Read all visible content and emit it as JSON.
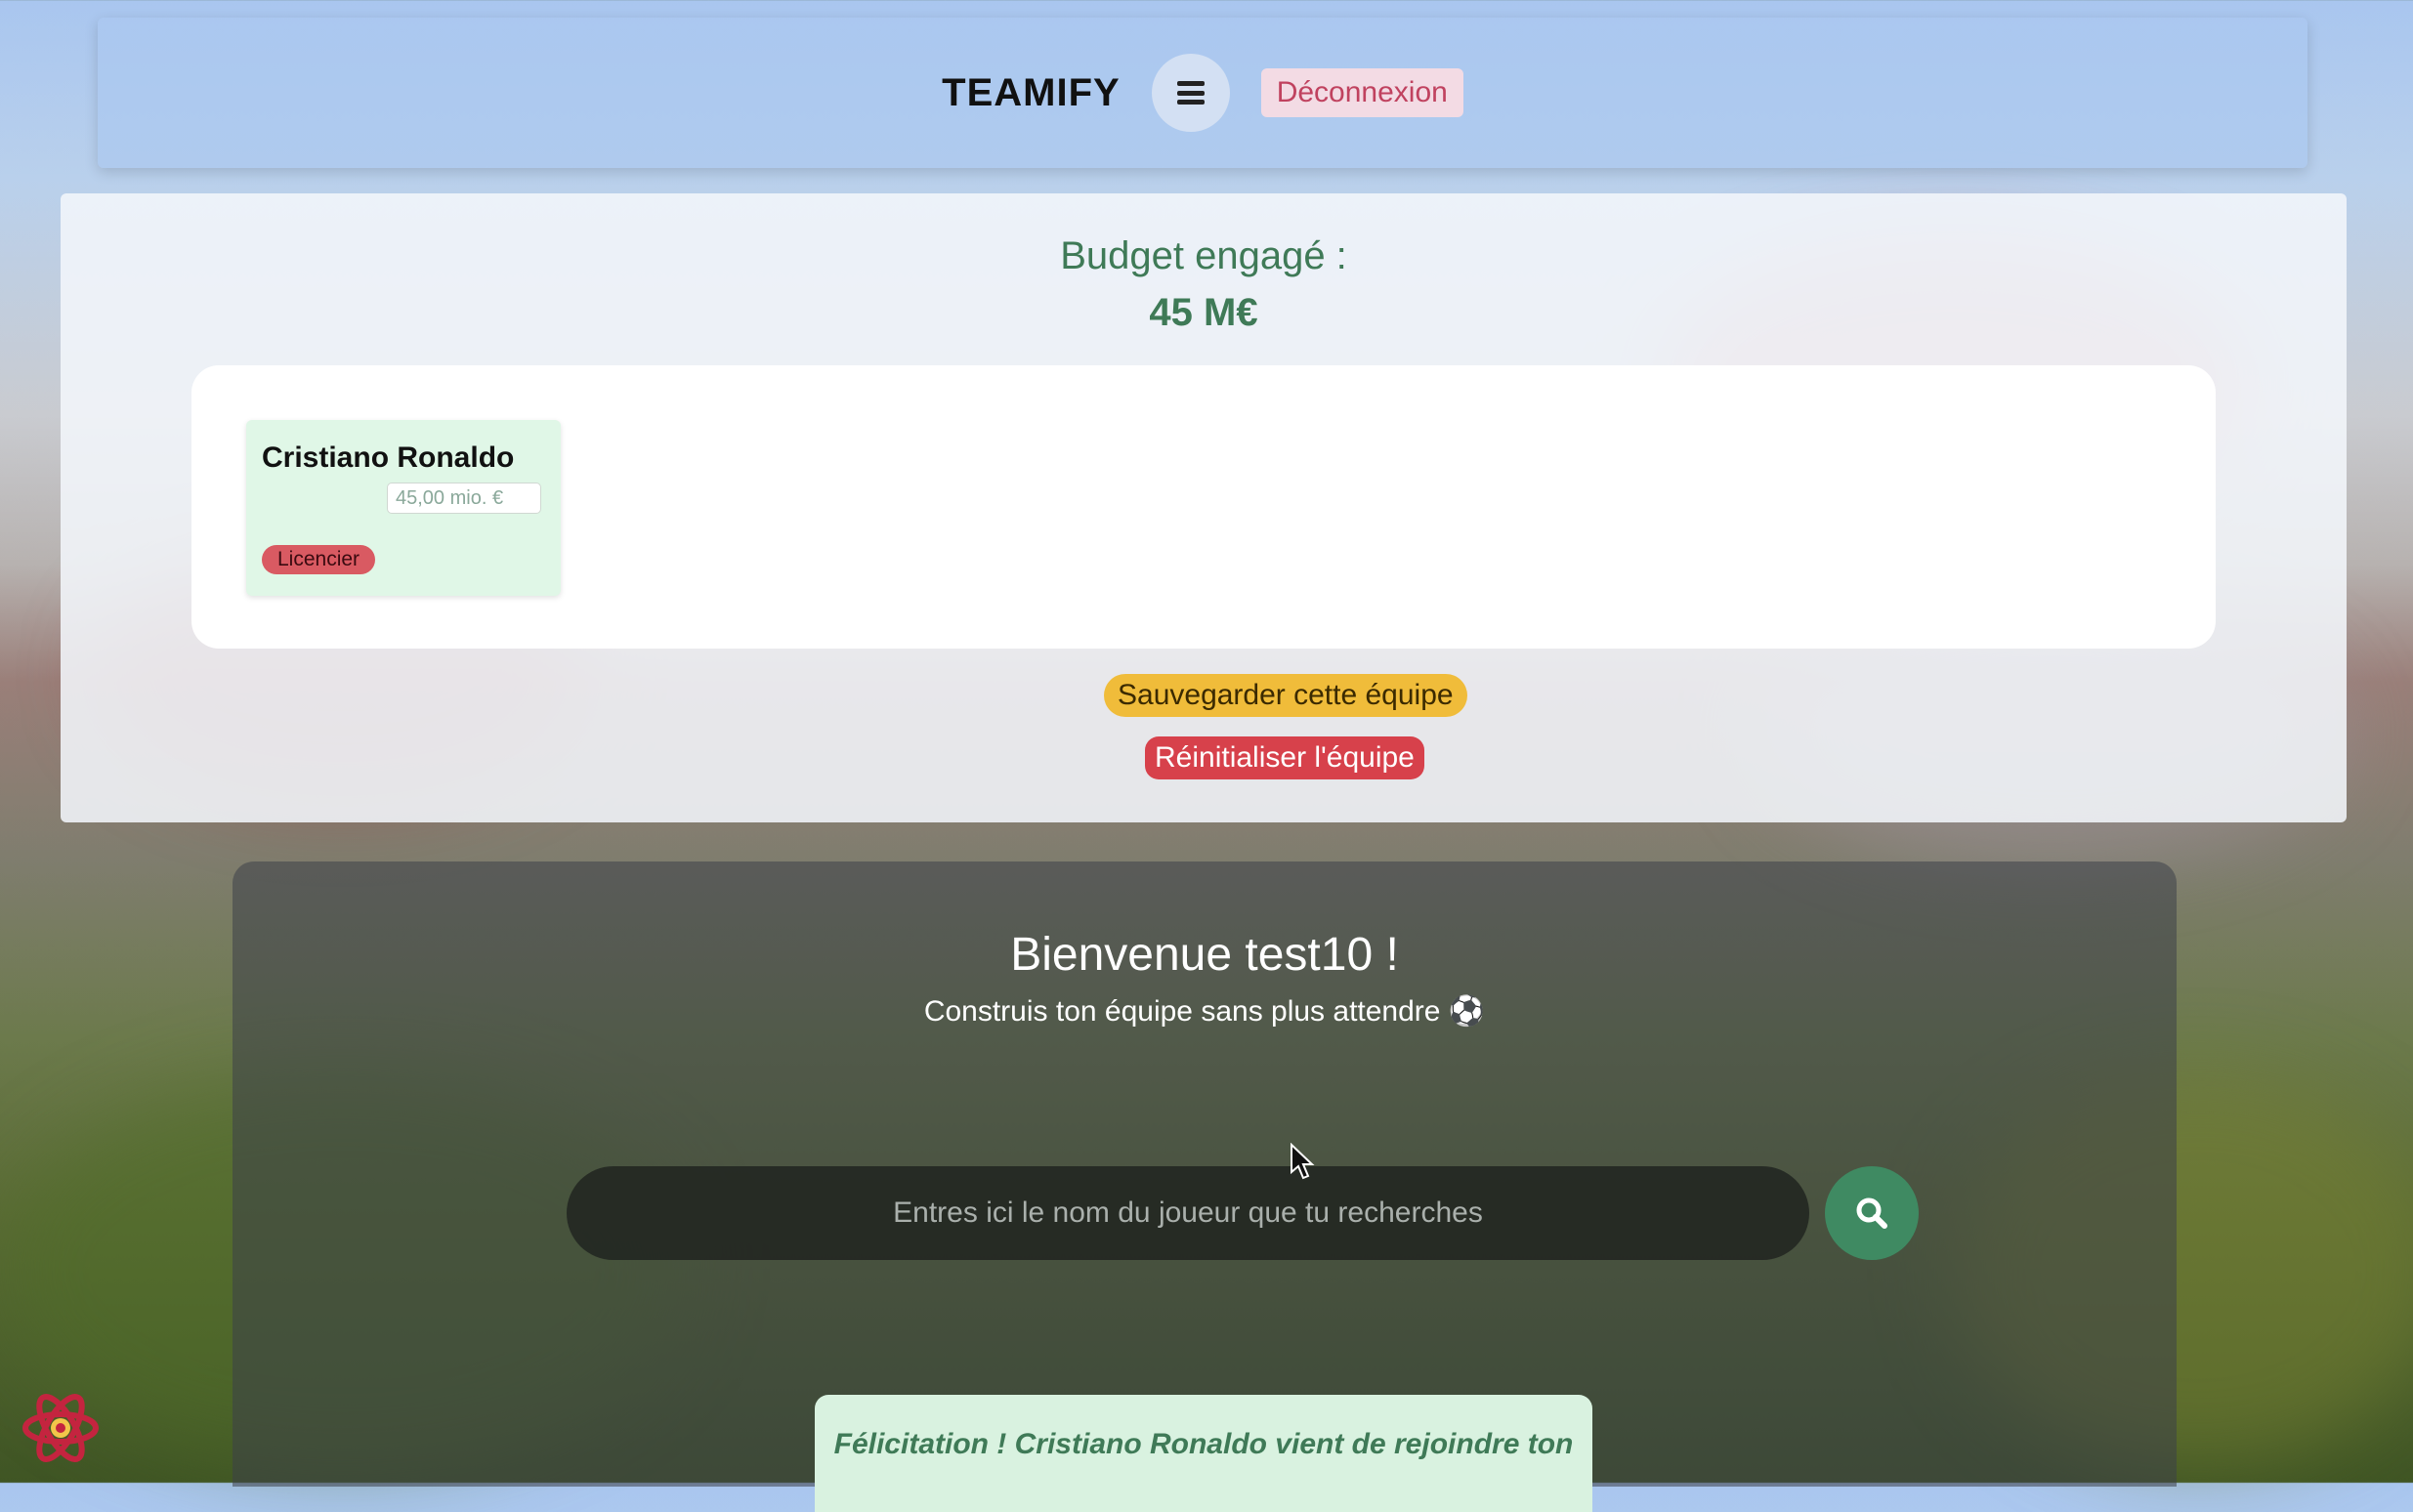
{
  "header": {
    "brand": "TEAMIFY",
    "menu_icon": "hamburger-menu-icon",
    "logout_label": "Déconnexion"
  },
  "budget": {
    "label": "Budget engagé :",
    "value": "45 M€"
  },
  "team": {
    "players": [
      {
        "name": "Cristiano Ronaldo",
        "price": "45,00 mio. €",
        "fire_label": "Licencier"
      }
    ]
  },
  "actions": {
    "save_label": "Sauvegarder cette équipe",
    "reset_label": "Réinitialiser l'équipe"
  },
  "hero": {
    "welcome": "Bienvenue test10 !",
    "tagline": "Construis ton équipe sans plus attendre ⚽",
    "search_placeholder": "Entres ici le nom du joueur que tu recherches",
    "search_icon": "search-icon"
  },
  "toast": {
    "message": "Félicitation ! Cristiano Ronaldo vient de rejoindre ton"
  },
  "colors": {
    "accent_green": "#3f7a57",
    "save_yellow": "#f0bc3a",
    "danger_red": "#d7414b",
    "logout_pink": "#c0425f"
  }
}
